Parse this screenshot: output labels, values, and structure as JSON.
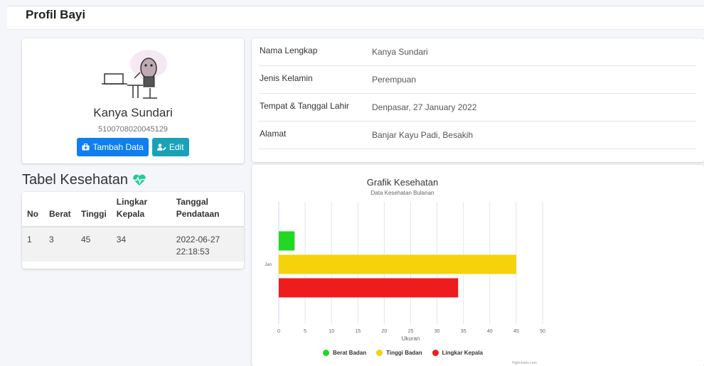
{
  "page": {
    "title": "Profil Bayi"
  },
  "profile": {
    "name": "Kanya Sundari",
    "nik": "5100708020045129",
    "add_button": "Tambah Data",
    "edit_button": "Edit"
  },
  "info": [
    {
      "label": "Nama Lengkap",
      "value": "Kanya Sundari"
    },
    {
      "label": "Jenis Kelamin",
      "value": "Perempuan"
    },
    {
      "label": "Tempat & Tanggal Lahir",
      "value": "Denpasar, 27 January 2022"
    },
    {
      "label": "Alamat",
      "value": "Banjar Kayu Padi, Besakih"
    }
  ],
  "table": {
    "title": "Tabel Kesehatan",
    "headers": [
      "No",
      "Berat",
      "Tinggi",
      "Lingkar Kepala",
      "Tanggal Pendataan"
    ],
    "rows": [
      {
        "no": "1",
        "berat": "3",
        "tinggi": "45",
        "lingkar": "34",
        "tanggal": "2022-06-27 22:18:53"
      }
    ]
  },
  "chart_data": {
    "type": "bar",
    "orientation": "horizontal",
    "title": "Grafik Kesehatan",
    "subtitle": "Data Kesehatan Bulanan",
    "categories": [
      "Jan"
    ],
    "xlabel": "Ukuran",
    "xlim": [
      0,
      50
    ],
    "ticks": [
      0,
      5,
      10,
      15,
      20,
      25,
      30,
      35,
      40,
      45,
      50
    ],
    "grid": true,
    "legend": "bottom",
    "series": [
      {
        "name": "Berat Badan",
        "values": [
          3
        ],
        "color": "#22d822"
      },
      {
        "name": "Tinggi Badan",
        "values": [
          45
        ],
        "color": "#f5d20a"
      },
      {
        "name": "Lingkar Kepala",
        "values": [
          34
        ],
        "color": "#ee1c1c"
      }
    ],
    "credit": "Highcharts.com"
  }
}
